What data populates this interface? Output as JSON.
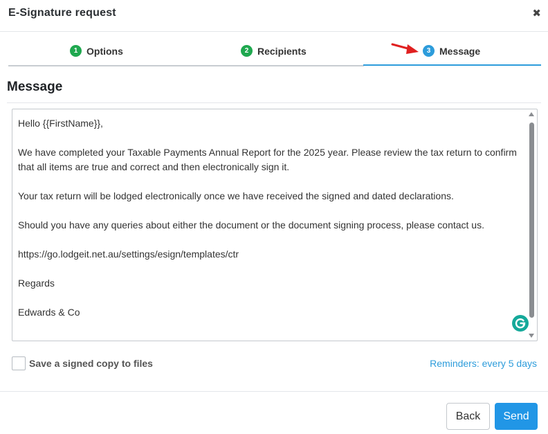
{
  "dialog": {
    "title": "E-Signature request",
    "close_glyph": "✖"
  },
  "tabs": [
    {
      "number": "1",
      "label": "Options",
      "status_color": "#1fa84f"
    },
    {
      "number": "2",
      "label": "Recipients",
      "status_color": "#1fa84f"
    },
    {
      "number": "3",
      "label": "Message",
      "status_color": "#2d9cdb",
      "active": true
    }
  ],
  "section": {
    "title": "Message"
  },
  "message": {
    "paragraphs": [
      "Hello {{FirstName}},",
      "We have completed your Taxable Payments Annual Report for the 2025 year. Please review the tax return to confirm that all items are true and correct and then electronically sign it.",
      "Your tax return will be lodged electronically once we have received the signed and dated declarations.",
      "Should you have any queries about either the document or the document signing process, please contact us.",
      "https://go.lodgeit.net.au/settings/esign/templates/ctr",
      "Regards",
      "Edwards & Co"
    ]
  },
  "options": {
    "save_copy_label": "Save a signed copy to files",
    "save_copy_checked": false,
    "reminders_label": "Reminders: every 5 days"
  },
  "footer": {
    "back_label": "Back",
    "send_label": "Send"
  },
  "colors": {
    "accent": "#2d9cdb",
    "complete": "#1fa84f",
    "primary_button": "#2196e6",
    "annotation_arrow": "#e02020"
  },
  "icons": {
    "close": "close-icon",
    "arrow": "red-arrow-annotation-icon",
    "grammarly": "grammarly-icon"
  }
}
